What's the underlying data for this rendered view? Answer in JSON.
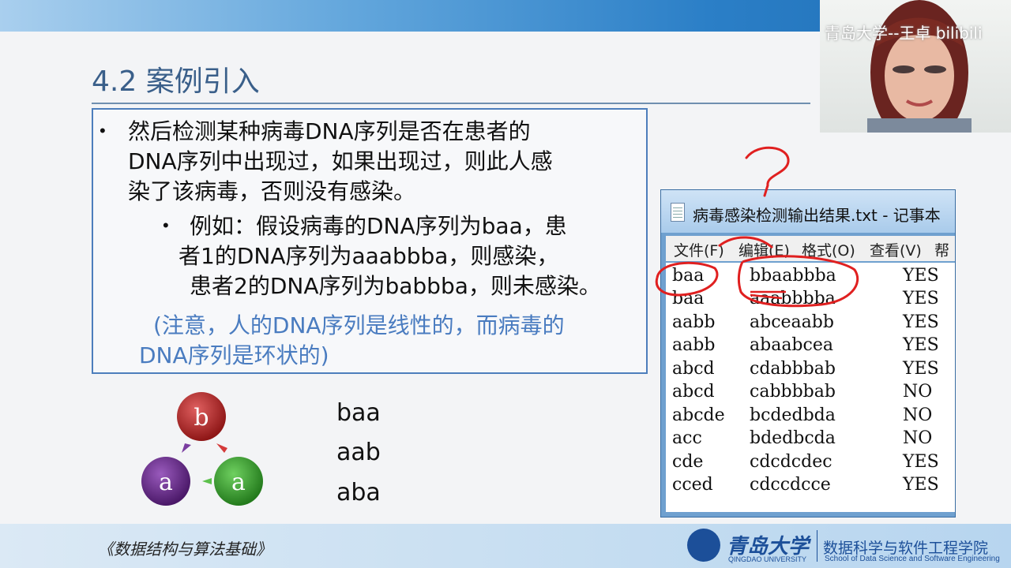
{
  "slide": {
    "title": "4.2 案例引入",
    "bullets": [
      {
        "lines": [
          "然后检测某种病毒DNA序列是否在患者的",
          "DNA序列中出现过，如果出现过，则此人感",
          "染了该病毒，否则没有感染。"
        ]
      },
      {
        "lines": [
          "例如：假设病毒的DNA序列为baa，患",
          "者1的DNA序列为aaabbba，则感染，",
          "患者2的DNA序列为babbba，则未感染。"
        ]
      }
    ],
    "note": [
      "(注意，人的DNA序列是线性的，而病毒的",
      "DNA序列是环状的)"
    ],
    "cycle_nodes": [
      "b",
      "a",
      "a"
    ],
    "rotations": [
      "baa",
      "aab",
      "aba"
    ]
  },
  "notepad": {
    "title": "病毒感染检测输出结果.txt - 记事本",
    "menu": [
      "文件(F)",
      "编辑(E)",
      "格式(O)",
      "查看(V)",
      "帮"
    ],
    "rows": [
      [
        "baa",
        "bbaabbba",
        "YES"
      ],
      [
        "baa",
        "aaabbbba",
        "YES"
      ],
      [
        "aabb",
        "abceaabb",
        "YES"
      ],
      [
        "aabb",
        "abaabcea",
        "YES"
      ],
      [
        "abcd",
        "cdabbbab",
        "YES"
      ],
      [
        "abcd",
        "cabbbbab",
        "NO"
      ],
      [
        "abcde",
        "bcdedbda",
        "NO"
      ],
      [
        "acc",
        "bdedbcda",
        "NO"
      ],
      [
        "cde",
        "cdcdcdec",
        "YES"
      ],
      [
        "cced",
        "cdccdcce",
        "YES"
      ]
    ]
  },
  "webcam": {
    "watermark": "青岛大学--王卓 bilibili"
  },
  "footer": {
    "book": "《数据结构与算法基础》",
    "university_cn": "青岛大学",
    "university_en": "QINGDAO UNIVERSITY",
    "college_cn": "数据科学与软件工程学院",
    "college_en": "School of Data Science and Software Engineering"
  },
  "colors": {
    "accent_blue": "#2b7fc7",
    "title_blue": "#3a5f8a",
    "note_blue": "#4a7cc0",
    "annotation_red": "#e02020",
    "node_b": "#b52a2a",
    "node_a_left": "#6a2a8a",
    "node_a_right": "#39a12f"
  }
}
